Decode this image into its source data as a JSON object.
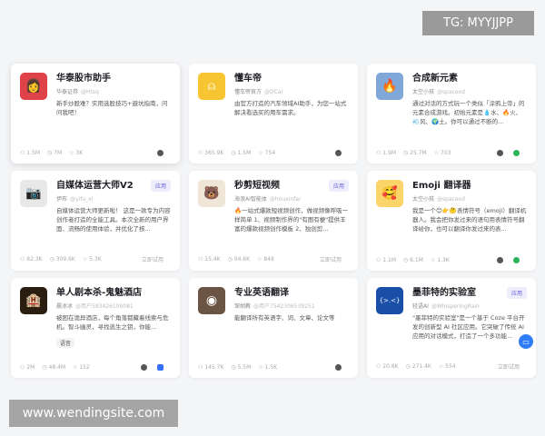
{
  "watermarks": {
    "top": "TG: MYYJJPP",
    "bottom": "www.wendingsite.com"
  },
  "cards": [
    {
      "title": "华泰股市助手",
      "author": "华泰证券",
      "handle": "@Htsq",
      "desc": "新手炒股难？实用选股技巧+避坑指南，问问我吧！",
      "users": "1.5M",
      "runs": "7M",
      "stars": "3K",
      "avatar_color": "#e0424a",
      "avatar_icon": "woman-avatar"
    },
    {
      "title": "懂车帝",
      "author": "懂车帝官方",
      "handle": "@DCar",
      "desc": "由官方打造的汽车领域AI助手，为您一站式解决看选买的用车需求。",
      "users": "365.9K",
      "runs": "1.5M",
      "stars": "754",
      "avatar_color": "#f7c531",
      "avatar_icon": "steering-wheel"
    },
    {
      "title": "合成新元素",
      "author": "太空小孩",
      "handle": "@spacexd",
      "desc": "通过对话的方式玩一个类似「涂鸦上帝」的元素合成游戏。初始元素是💧水、🔥火、💨风、🌍土。你可以通过不断的...",
      "users": "1.9M",
      "runs": "25.7M",
      "stars": "703",
      "avatar_color": "#7fa8d8",
      "avatar_icon": "fire-water"
    },
    {
      "title": "自媒体运营大师V2",
      "author": "伊布",
      "handle": "@yifu_xi",
      "desc": "自媒体运营大师更新啦！ 这是一款专为内容创作者打造的全能工具。本次全新的用户界面、流畅的使用体验，并优化了核...",
      "users": "82.3K",
      "runs": "309.6K",
      "stars": "5.3K",
      "badge": "应用",
      "try": "立即试用",
      "avatar_color": "#e8e8e8",
      "avatar_icon": "camera"
    },
    {
      "title": "秒剪短视频",
      "author": "海浪AI智能体",
      "handle": "@houxinfar",
      "desc": "🔥一站式爆款短视频创作，做视频像呼吸一样简单 1、视频制作界的\"有图有梗\"提供丰富的爆款视频创作模板 2、独创剪...",
      "users": "15.4K",
      "runs": "94.6K",
      "stars": "848",
      "badge": "应用",
      "try": "立即试用",
      "avatar_color": "#f0e6d8",
      "avatar_icon": "bear"
    },
    {
      "title": "Emoji 翻译器",
      "author": "太空小孩",
      "handle": "@spacexd",
      "desc": "我是一个😊👉🤔表情符号（emoji）翻译机器人。我会把你发过来的语句用表情符号翻译给你，也可以翻译你发过来的表...",
      "users": "1.1M",
      "runs": "6.1M",
      "stars": "1.3K",
      "avatar_color": "#fbd46a",
      "avatar_icon": "emoji-face"
    },
    {
      "title": "单人剧本杀-鬼魅酒店",
      "author": "晨冰冰",
      "handle": "@用户583426109081",
      "desc": "被困在诡异酒店，每个角落都藏着线索与危机。智斗幽灵，寻找逃生之钥，你能...",
      "tag": "语音",
      "users": "2M",
      "runs": "48.4M",
      "stars": "152",
      "avatar_color": "#2a1e10",
      "avatar_icon": "hotel"
    },
    {
      "title": "专业英语翻译",
      "author": "琛胡教",
      "handle": "@用户7542306539251",
      "desc": "能翻译所有英语字、词、文章、论文等",
      "users": "145.7K",
      "runs": "5.5M",
      "stars": "1.5K",
      "avatar_color": "#6b5443",
      "avatar_icon": "seal"
    },
    {
      "title": "墨菲特的实验室",
      "author": "轻语AI",
      "handle": "@WhisperingRain",
      "desc": "\"墨菲特的实验室\"是一个基于 Coze 平台开发的创新型 AI 社区应用。它突破了传统 AI 应用的对话模式，打造了一个多功能...",
      "users": "20.8K",
      "runs": "271.4K",
      "stars": "554",
      "badge": "应用",
      "try": "立即试用",
      "avatar_color": "#1a4fa8",
      "avatar_icon": "code-face"
    }
  ]
}
